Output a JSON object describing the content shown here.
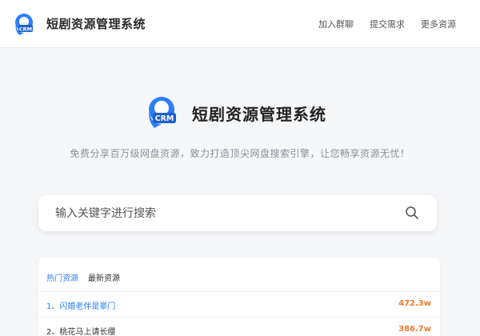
{
  "colors": {
    "accent": "#2d7ff9",
    "hot": "#f07a2c",
    "logo": "#2d7ff9"
  },
  "header": {
    "brand": "短剧资源管理系统",
    "logo_icon": "crm-logo-icon",
    "nav": [
      "加入群聊",
      "提交需求",
      "更多资源"
    ]
  },
  "hero": {
    "title": "短剧资源管理系统",
    "logo_text": "CRM",
    "slogan": "免费分享百万级网盘资源，致力打造顶尖网盘搜索引擎，让您畅享资源无忧！"
  },
  "search": {
    "placeholder": "输入关键字进行搜索",
    "value": "",
    "icon": "search-icon"
  },
  "list": {
    "tabs": [
      "热门资源",
      "最新资源"
    ],
    "active_tab": 0,
    "items": [
      {
        "rank": "1、",
        "title": "闪婚老伴是豪门",
        "count": "472.3w",
        "color": "#2d7ff9"
      },
      {
        "rank": "2、",
        "title": "桃花马上请长缨",
        "count": "386.7w",
        "color": "#333333"
      }
    ]
  }
}
